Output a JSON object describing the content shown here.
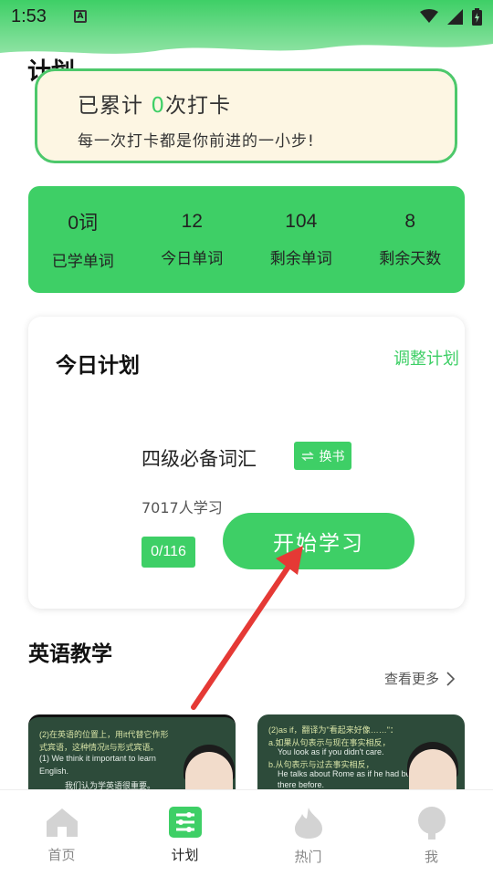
{
  "status_bar": {
    "time": "1:53",
    "a_icon": "A"
  },
  "header": {
    "title": "计划"
  },
  "checkin": {
    "prefix": "已累计 ",
    "count": "0",
    "suffix": "次打卡",
    "subtitle": "每一次打卡都是你前进的一小步!"
  },
  "stats": [
    {
      "value": "0词",
      "label": "已学单词"
    },
    {
      "value": "12",
      "label": "今日单词"
    },
    {
      "value": "104",
      "label": "剩余单词"
    },
    {
      "value": "8",
      "label": "剩余天数"
    }
  ],
  "plan": {
    "title": "今日计划",
    "adjust_label": "调整计划",
    "book_name": "四级必备词汇",
    "swap_label": "换书",
    "swap_icon": "swap-arrows-icon",
    "learners": "7017人学习",
    "progress": "0/116",
    "start_label": "开始学习"
  },
  "english": {
    "title": "英语教学",
    "more_label": "查看更多",
    "videos": [
      {
        "lines": [
          "(2)在英语的位置上，用it代替它作形",
          "式宾语，这种情况it与形式宾语。",
          "(1) We think it important to learn",
          "English.",
          "我们认为学英语很重要。"
        ]
      },
      {
        "lines": [
          "(2)as if，翻译为\"看起来好像……\"：",
          "a.如果从句表示与现在事实相反，",
          "You look as if you didn't care.",
          "b.从句表示与过去事实相反，",
          "He talks about Rome as if he had been",
          "there before."
        ]
      }
    ]
  },
  "tabbar": [
    {
      "label": "首页",
      "icon": "home-icon"
    },
    {
      "label": "计划",
      "icon": "plan-sliders-icon"
    },
    {
      "label": "热门",
      "icon": "flame-icon"
    },
    {
      "label": "我",
      "icon": "person-icon"
    }
  ],
  "colors": {
    "accent": "#3ecf66",
    "card_bg": "#fdf6e3"
  }
}
